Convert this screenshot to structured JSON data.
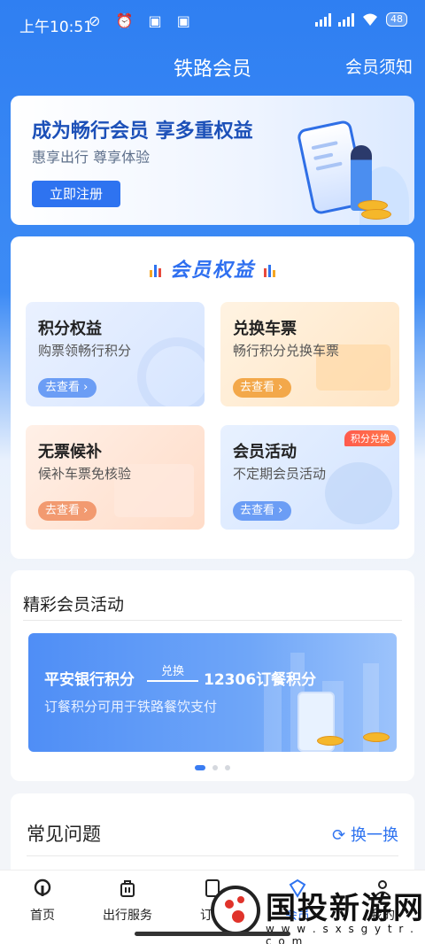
{
  "status": {
    "time": "上午10:51",
    "battery": "48"
  },
  "header": {
    "title": "铁路会员",
    "notice": "会员须知"
  },
  "hero": {
    "headline": "成为畅行会员 享多重权益",
    "subline": "惠享出行 尊享体验",
    "button": "立即注册"
  },
  "benefits": {
    "heading": "会员权益",
    "tiles": [
      {
        "title": "积分权益",
        "desc": "购票领畅行积分",
        "action": "去查看"
      },
      {
        "title": "兑换车票",
        "desc": "畅行积分兑换车票",
        "action": "去查看"
      },
      {
        "title": "无票候补",
        "desc": "候补车票免核验",
        "action": "去查看"
      },
      {
        "title": "会员活动",
        "desc": "不定期会员活动",
        "action": "去查看",
        "badge": "积分兑换"
      }
    ]
  },
  "activities": {
    "heading": "精彩会员活动",
    "banner": {
      "left": "平安银行积分",
      "arrow": "兑换",
      "right": "12306订餐积分",
      "sub": "订餐积分可用于铁路餐饮支付"
    },
    "active_page": 1,
    "pages": 3
  },
  "faq": {
    "heading": "常见问题",
    "swap": "换一换"
  },
  "tabs": [
    {
      "label": "首页",
      "icon": "train-logo-icon"
    },
    {
      "label": "出行服务",
      "icon": "luggage-icon"
    },
    {
      "label": "订单",
      "icon": "order-icon"
    },
    {
      "label": "会员",
      "icon": "member-icon"
    },
    {
      "label": "我的",
      "icon": "user-icon"
    }
  ],
  "watermark": {
    "title": "国投新游网",
    "url": "w w w . s x s g y t r . c o m"
  },
  "colors": {
    "primary": "#2e73f0",
    "badge": "#ff5a4d"
  }
}
